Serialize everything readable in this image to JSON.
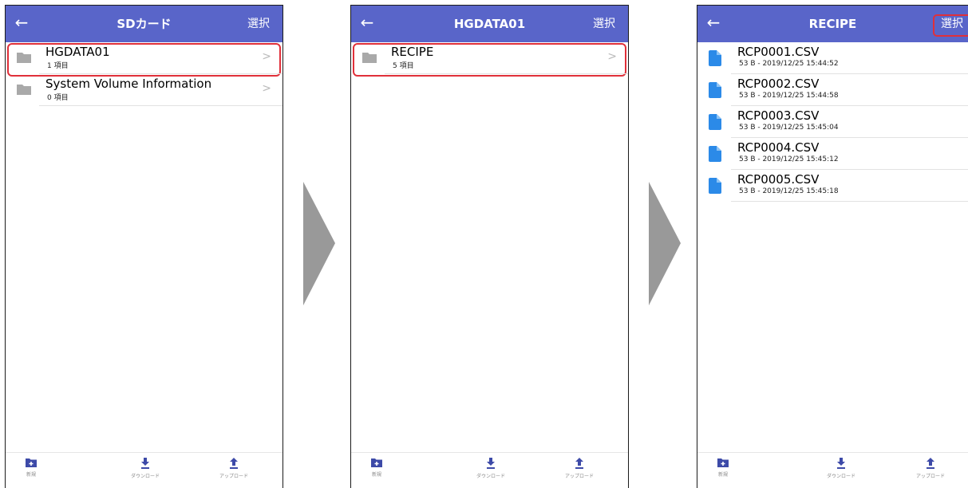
{
  "colors": {
    "header": "#5965c9",
    "highlight": "#e0303a",
    "folder_icon": "#a9a9a9",
    "file_icon": "#2b8ae8",
    "toolbar_icon": "#3d4aa8",
    "step_arrow": "#999999"
  },
  "screens": [
    {
      "header": {
        "back_icon": "arrow-left-icon",
        "title": "SDカード",
        "select_label": "選択"
      },
      "items": [
        {
          "icon": "folder-icon",
          "name": "HGDATA01",
          "subtitle": "1 項目",
          "highlighted": true
        },
        {
          "icon": "folder-icon",
          "name": "System Volume Information",
          "subtitle": "0 項目",
          "highlighted": false
        }
      ],
      "toolbar": {
        "new_label": "新規",
        "download_label": "ダウンロード",
        "upload_label": "アップロード"
      }
    },
    {
      "header": {
        "back_icon": "arrow-left-icon",
        "title": "HGDATA01",
        "select_label": "選択"
      },
      "items": [
        {
          "icon": "folder-icon",
          "name": "RECIPE",
          "subtitle": "5 項目",
          "highlighted": true
        }
      ],
      "toolbar": {
        "new_label": "新規",
        "download_label": "ダウンロード",
        "upload_label": "アップロード"
      }
    },
    {
      "header": {
        "back_icon": "arrow-left-icon",
        "title": "RECIPE",
        "select_label": "選択",
        "select_highlighted": true
      },
      "items": [
        {
          "icon": "file-icon",
          "name": "RCP0001.CSV",
          "subtitle": "53 B - 2019/12/25 15:44:52"
        },
        {
          "icon": "file-icon",
          "name": "RCP0002.CSV",
          "subtitle": "53 B - 2019/12/25 15:44:58"
        },
        {
          "icon": "file-icon",
          "name": "RCP0003.CSV",
          "subtitle": "53 B - 2019/12/25 15:45:04"
        },
        {
          "icon": "file-icon",
          "name": "RCP0004.CSV",
          "subtitle": "53 B - 2019/12/25 15:45:12"
        },
        {
          "icon": "file-icon",
          "name": "RCP0005.CSV",
          "subtitle": "53 B - 2019/12/25 15:45:18"
        }
      ],
      "toolbar": {
        "new_label": "新規",
        "download_label": "ダウンロード",
        "upload_label": "アップロード"
      }
    }
  ]
}
